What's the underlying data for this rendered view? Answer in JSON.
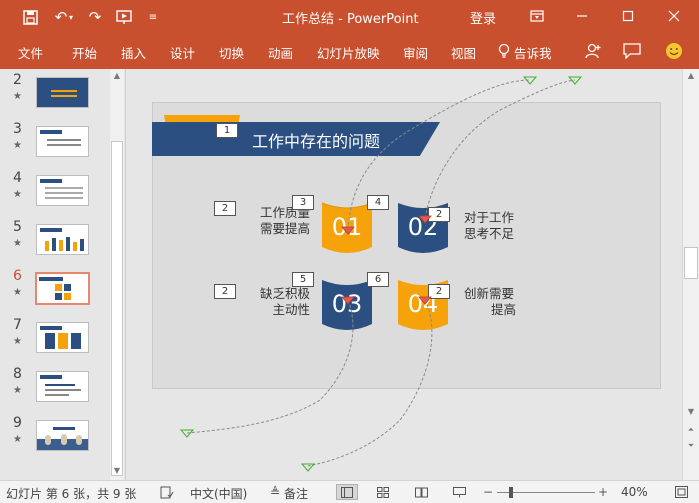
{
  "title_bar": {
    "doc_title": "工作总结  -  PowerPoint",
    "signin": "登录"
  },
  "ribbon": {
    "tabs": [
      "文件",
      "开始",
      "插入",
      "设计",
      "切换",
      "动画",
      "幻灯片放映",
      "审阅",
      "视图",
      "告诉我"
    ]
  },
  "thumbnails": [
    {
      "num": "2",
      "star": "★"
    },
    {
      "num": "3",
      "star": "★"
    },
    {
      "num": "4",
      "star": "★"
    },
    {
      "num": "5",
      "star": "★"
    },
    {
      "num": "6",
      "star": "★"
    },
    {
      "num": "7",
      "star": "★"
    },
    {
      "num": "8",
      "star": "★"
    },
    {
      "num": "9",
      "star": "★"
    }
  ],
  "slide": {
    "title": "工作中存在的问题",
    "title_tag": "1",
    "items": [
      {
        "num": "01",
        "text_l1": "工作质量",
        "text_l2": "需要提高",
        "tag_left": "2",
        "tag_cyl": "3"
      },
      {
        "num": "02",
        "text_l1": "对于工作",
        "text_l2": "思考不足",
        "tag_right": "2",
        "tag_cyl": "4"
      },
      {
        "num": "03",
        "text_l1": "缺乏积极",
        "text_l2": "主动性",
        "tag_left": "2",
        "tag_cyl": "5"
      },
      {
        "num": "04",
        "text_l1": "创新需要",
        "text_l2": "提高",
        "tag_right": "2",
        "tag_cyl": "6"
      }
    ]
  },
  "status": {
    "slide_info": "幻灯片 第 6 张，共 9 张",
    "language": "中文(中国)",
    "notes": "备注",
    "zoom": "40%"
  },
  "colors": {
    "accent": "#c8502f",
    "navy": "#2b4f80",
    "orange": "#f6a20b"
  }
}
